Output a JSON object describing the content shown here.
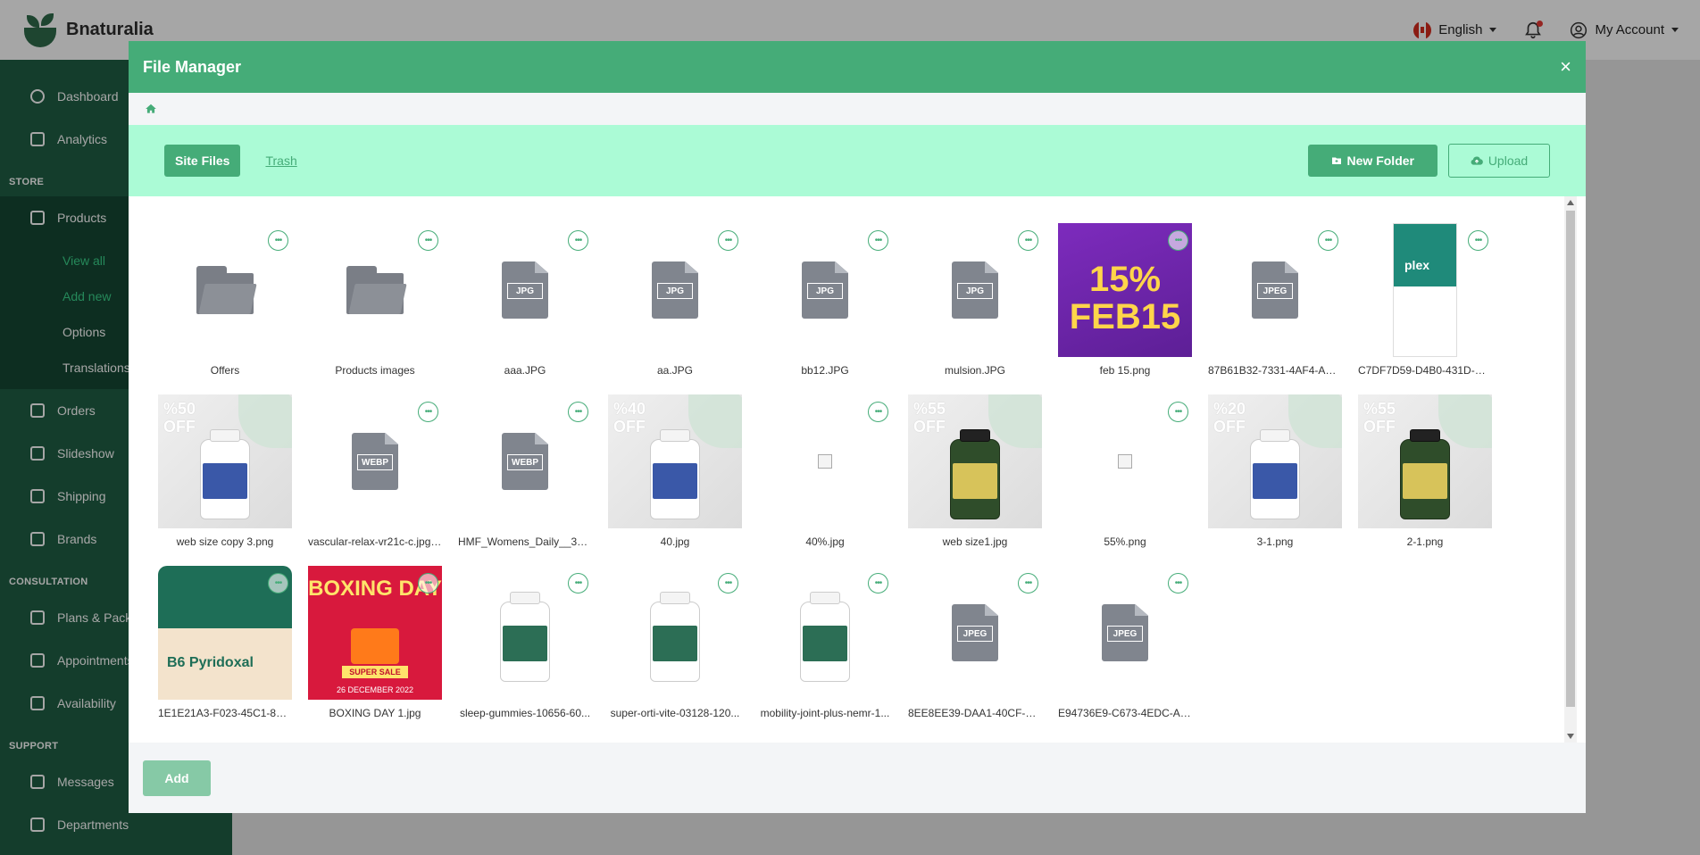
{
  "app": {
    "brand": "Bnaturalia"
  },
  "topbar": {
    "language": "English",
    "account": "My Account"
  },
  "sidebar": {
    "items_top": [
      {
        "label": "Dashboard",
        "icon": "dashboard-icon"
      },
      {
        "label": "Analytics",
        "icon": "analytics-icon"
      }
    ],
    "section_store": "STORE",
    "products": "Products",
    "products_sub": [
      "View all",
      "Add new",
      "Options",
      "Translations"
    ],
    "store_items": [
      "Orders",
      "Slideshow",
      "Shipping",
      "Brands"
    ],
    "section_consultation": "CONSULTATION",
    "consultation_items": [
      "Plans & Packag",
      "Appointments",
      "Availability"
    ],
    "section_support": "SUPPORT",
    "support_items": [
      "Messages",
      "Departments"
    ]
  },
  "modal": {
    "title": "File Manager",
    "close": "×",
    "tabs": {
      "site_files": "Site Files",
      "trash": "Trash"
    },
    "new_folder": "New Folder",
    "upload": "Upload",
    "add": "Add",
    "files": [
      {
        "name": "Offers",
        "kind": "folder"
      },
      {
        "name": "Products images",
        "kind": "folder"
      },
      {
        "name": "aaa.JPG",
        "kind": "doc",
        "ext": "JPG"
      },
      {
        "name": "aa.JPG",
        "kind": "doc",
        "ext": "JPG"
      },
      {
        "name": "bb12.JPG",
        "kind": "doc",
        "ext": "JPG"
      },
      {
        "name": "mulsion.JPG",
        "kind": "doc",
        "ext": "JPG"
      },
      {
        "name": "feb 15.png",
        "kind": "image",
        "variant": "feb"
      },
      {
        "name": "87B61B32-7331-4AF4-ACO...",
        "kind": "doc",
        "ext": "JPEG"
      },
      {
        "name": "C7DF7D59-D4B0-431D-A7...",
        "kind": "image",
        "variant": "plex"
      },
      {
        "name": "web size copy 3.png",
        "kind": "image",
        "variant": "promo",
        "pct": "%50",
        "off": "OFF"
      },
      {
        "name": "vascular-relax-vr21c-c.jpg....",
        "kind": "doc",
        "ext": "WEBP"
      },
      {
        "name": "HMF_Womens_Daily__396...",
        "kind": "doc",
        "ext": "WEBP"
      },
      {
        "name": "40.jpg",
        "kind": "image",
        "variant": "promo",
        "pct": "%40",
        "off": "OFF"
      },
      {
        "name": "40%.jpg",
        "kind": "broken"
      },
      {
        "name": "web size1.jpg",
        "kind": "image",
        "variant": "promo-dark",
        "pct": "%55",
        "off": "OFF"
      },
      {
        "name": "55%.png",
        "kind": "broken"
      },
      {
        "name": "3-1.png",
        "kind": "image",
        "variant": "promo",
        "pct": "%20",
        "off": "OFF"
      },
      {
        "name": "2-1.png",
        "kind": "image",
        "variant": "promo-dark",
        "pct": "%55",
        "off": "OFF"
      },
      {
        "name": "1E1E21A3-F023-45C1-815B...",
        "kind": "image",
        "variant": "genestra"
      },
      {
        "name": "BOXING DAY 1.jpg",
        "kind": "image",
        "variant": "boxing"
      },
      {
        "name": "sleep-gummies-10656-60...",
        "kind": "image",
        "variant": "bottle"
      },
      {
        "name": "super-orti-vite-03128-120...",
        "kind": "image",
        "variant": "bottle"
      },
      {
        "name": "mobility-joint-plus-nemr-1...",
        "kind": "image",
        "variant": "bottle"
      },
      {
        "name": "8EE8EE39-DAA1-40CF-AO...",
        "kind": "doc",
        "ext": "JPEG"
      },
      {
        "name": "E94736E9-C673-4EDC-AO...",
        "kind": "doc",
        "ext": "JPEG"
      }
    ],
    "feb_image": {
      "big": "15%",
      "big2": "FEB15"
    },
    "plex_image": {
      "text": "plex"
    },
    "genestra_image": {
      "text": "B6 Pyridoxal"
    },
    "boxing_image": {
      "title": "BOXING DAY",
      "sale": "SUPER SALE",
      "date": "26 DECEMBER 2022"
    }
  },
  "colors": {
    "primary": "#45ac78",
    "toolbar_bg": "#abfbd6",
    "sidebar_bg": "#1f5e44"
  }
}
